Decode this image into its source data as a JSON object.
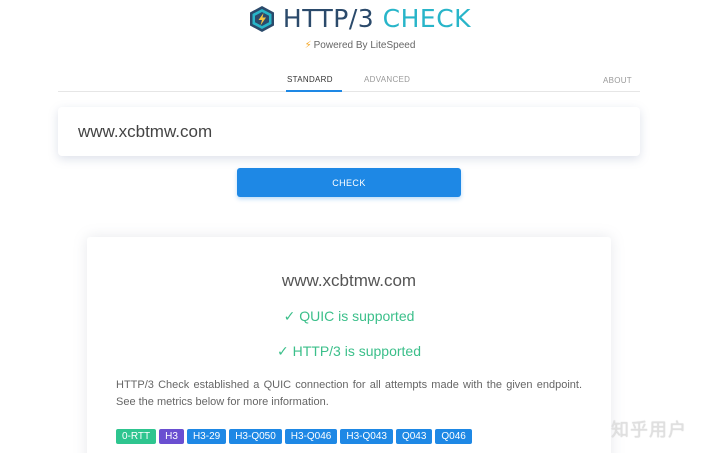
{
  "brand": {
    "title_main": "HTTP/3",
    "title_accent": "CHECK",
    "powered": "Powered By LiteSpeed"
  },
  "tabs": {
    "standard": "STANDARD",
    "advanced": "ADVANCED",
    "about": "ABOUT"
  },
  "search": {
    "value": "www.xcbtmw.com"
  },
  "check_button": "CHECK",
  "result": {
    "host": "www.xcbtmw.com",
    "quic": "✓ QUIC is supported",
    "http3": "✓ HTTP/3 is supported",
    "description": "HTTP/3 Check established a QUIC connection for all attempts made with the given endpoint. See the metrics below for more information.",
    "badges": [
      {
        "label": "0-RTT",
        "color": "#2ec58f"
      },
      {
        "label": "H3",
        "color": "#6a4fd1"
      },
      {
        "label": "H3-29",
        "color": "#1e88e5"
      },
      {
        "label": "H3-Q050",
        "color": "#1e88e5"
      },
      {
        "label": "H3-Q046",
        "color": "#1e88e5"
      },
      {
        "label": "H3-Q043",
        "color": "#1e88e5"
      },
      {
        "label": "Q043",
        "color": "#1e88e5"
      },
      {
        "label": "Q046",
        "color": "#1e88e5"
      }
    ]
  },
  "watermark": "知乎用户",
  "colors": {
    "accent": "#1e88e5",
    "success": "#3bbf8a",
    "brand_dark": "#2b4a6b",
    "brand_teal": "#28b5c9"
  },
  "icons": {
    "logo": "litespeed-hex-logo-icon",
    "bolt": "bolt-icon",
    "check": "check-icon"
  }
}
